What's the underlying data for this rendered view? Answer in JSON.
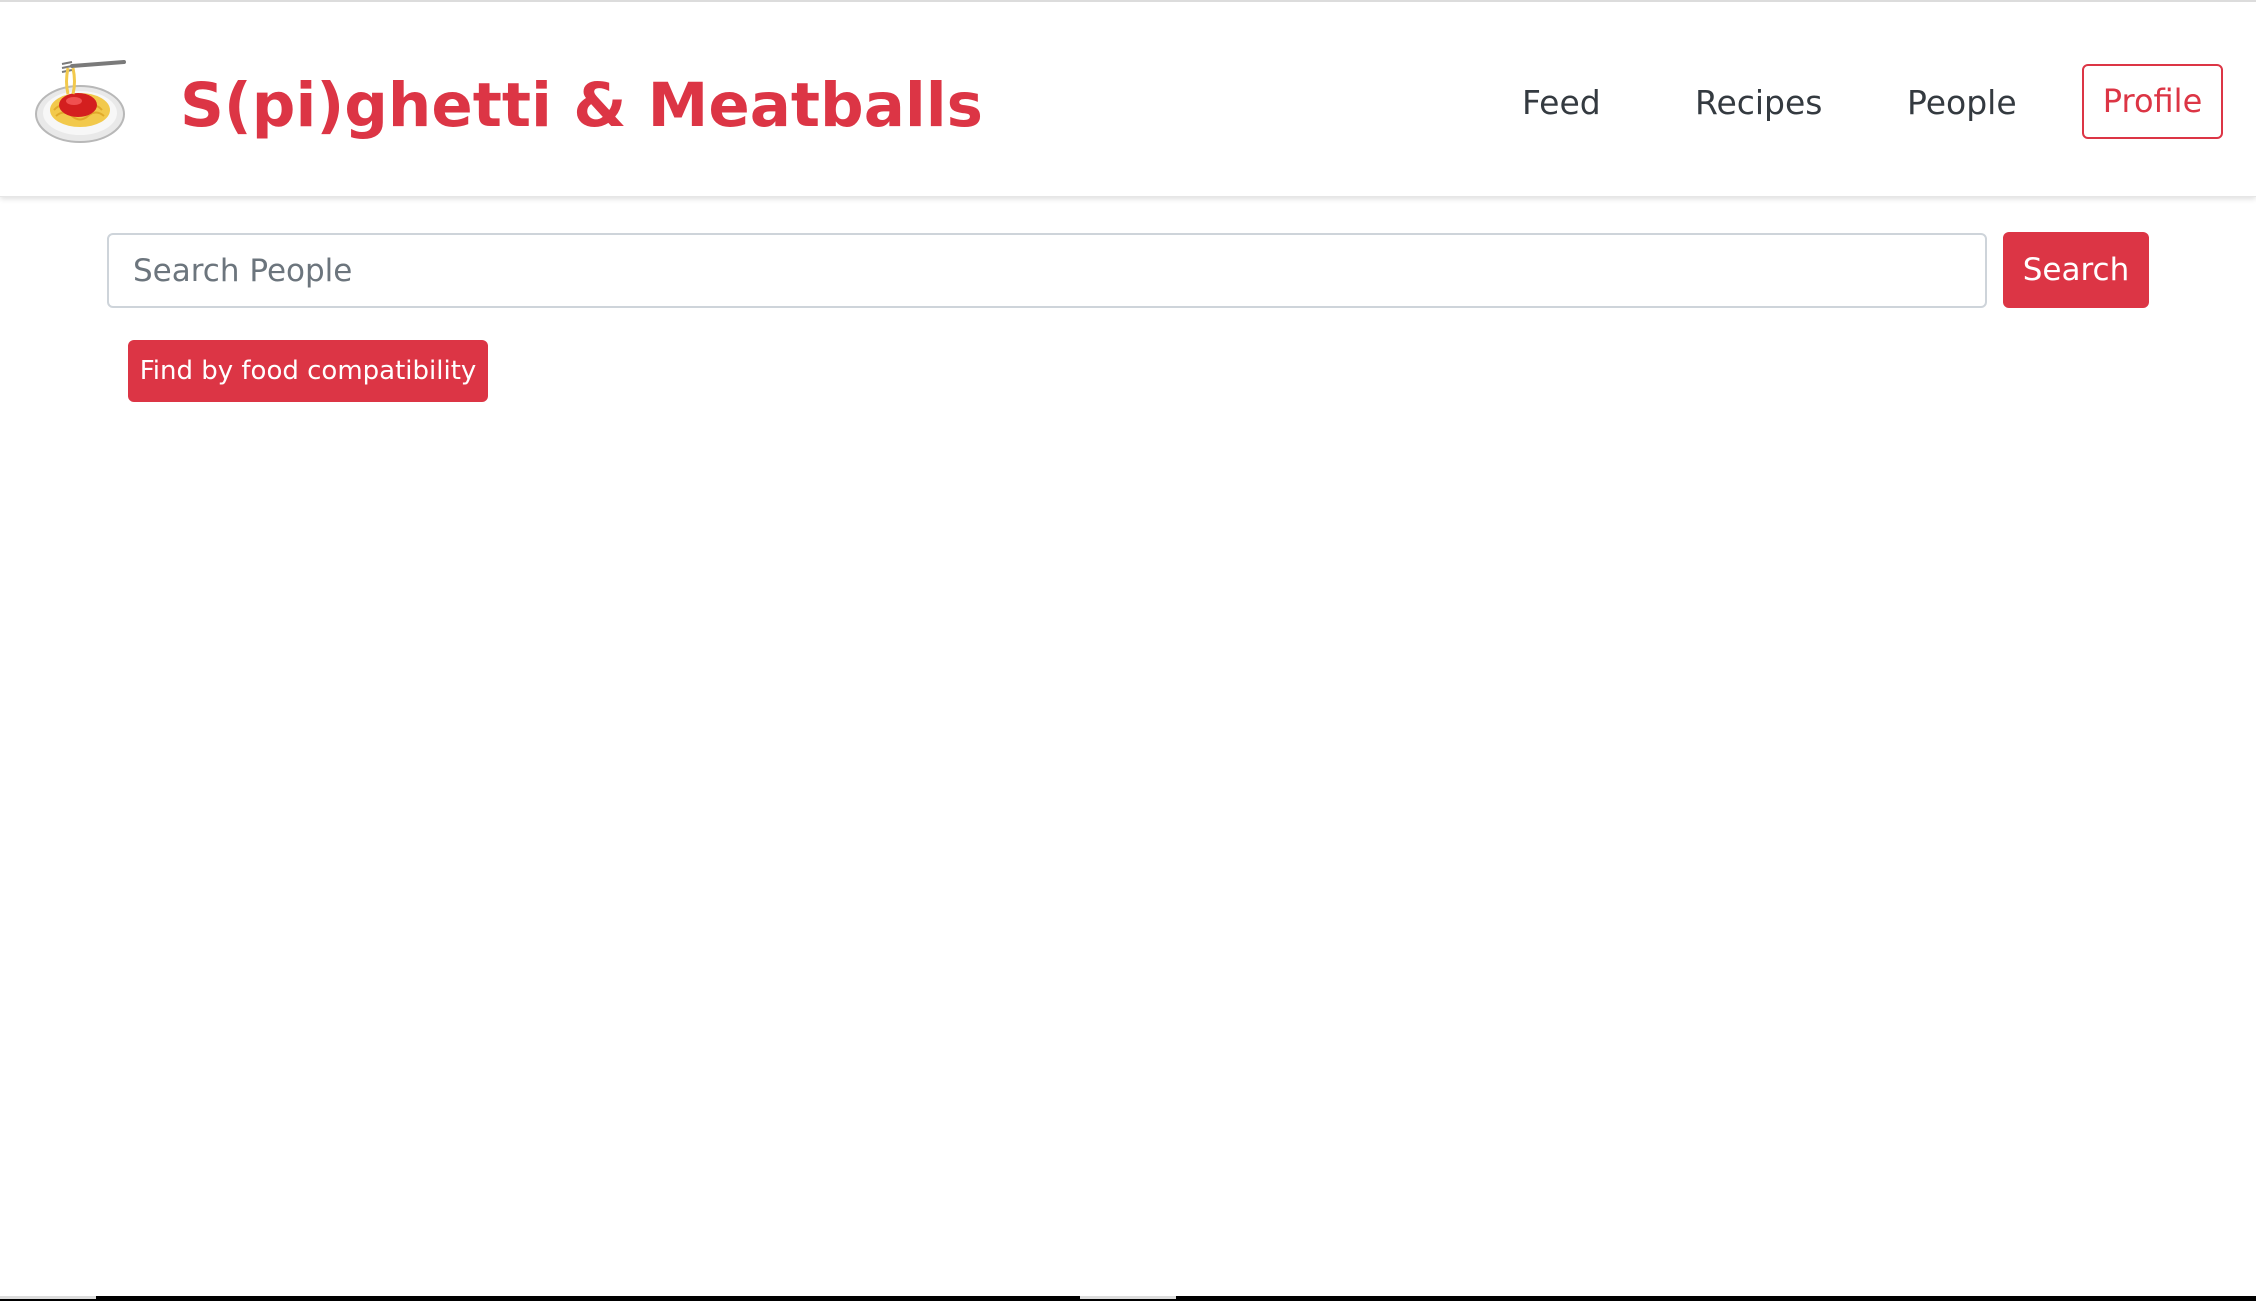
{
  "brand": {
    "title": "S(pi)ghetti & Meatballs",
    "logo_icon": "spaghetti-icon",
    "color": "#dc3545"
  },
  "nav": {
    "links": [
      {
        "label": "Feed"
      },
      {
        "label": "Recipes"
      },
      {
        "label": "People"
      }
    ],
    "profile_label": "Profile",
    "text_color": "#343a40"
  },
  "search": {
    "value": "",
    "placeholder": "Search People",
    "button_label": "Search"
  },
  "actions": {
    "compatibility_label": "Find by food compatibility"
  },
  "colors": {
    "accent": "#dc3545",
    "background": "#ffffff"
  }
}
